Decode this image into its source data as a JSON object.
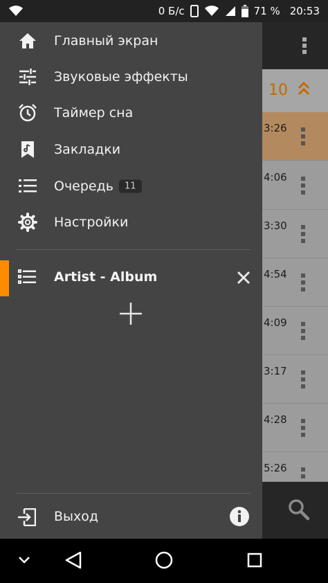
{
  "status_bar": {
    "net_speed": "0 Б/с",
    "battery_percent": "71 %",
    "time": "20:53",
    "icons": [
      "wifi-icon",
      "phone-icon",
      "wifi-signal-icon",
      "cell-signal-icon",
      "battery-icon"
    ]
  },
  "drawer": {
    "items": [
      {
        "label": "Главный экран",
        "icon": "home-icon"
      },
      {
        "label": "Звуковые эффекты",
        "icon": "equalizer-icon"
      },
      {
        "label": "Таймер сна",
        "icon": "alarm-icon"
      },
      {
        "label": "Закладки",
        "icon": "bookmark-icon"
      },
      {
        "label": "Очередь",
        "icon": "queue-icon",
        "badge": "11"
      },
      {
        "label": "Настройки",
        "icon": "gear-icon"
      }
    ],
    "playlist": {
      "label": "Artist - Album",
      "icon": "playlist-icon"
    },
    "exit_label": "Выход",
    "accent_color": "#ff8c00"
  },
  "background_app": {
    "track_count": "10",
    "durations": [
      "3:26",
      "4:06",
      "3:30",
      "4:54",
      "4:09",
      "3:17",
      "4:28",
      "5:26"
    ],
    "active_color": "#b38a5f"
  }
}
